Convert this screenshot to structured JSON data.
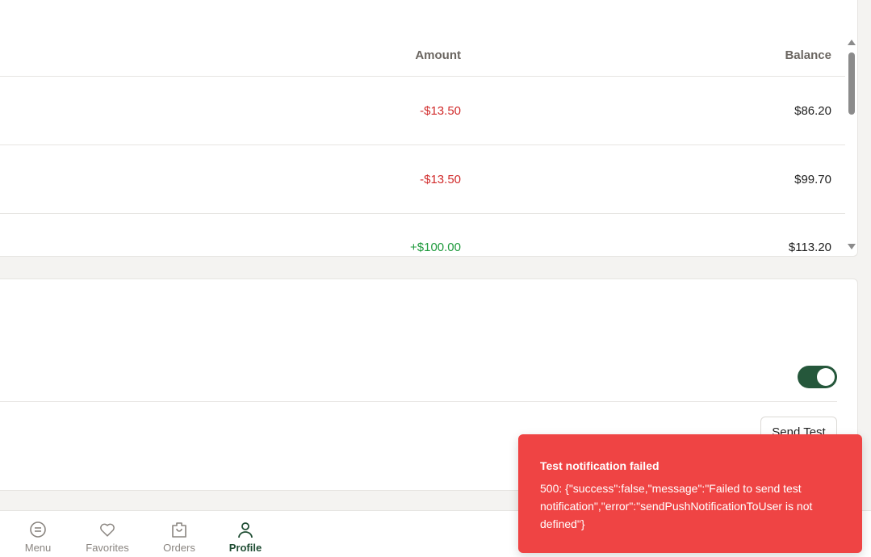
{
  "transactions": {
    "headers": {
      "amount": "Amount",
      "balance": "Balance"
    },
    "rows": [
      {
        "amount": "-$13.50",
        "balance": "$86.20"
      },
      {
        "amount": "-$13.50",
        "balance": "$99.70"
      },
      {
        "amount": "+$100.00",
        "balance": "$113.20"
      }
    ]
  },
  "notifications": {
    "toggle_on": true,
    "send_test_label": "Send Test"
  },
  "nav": {
    "items": [
      {
        "label": "Menu",
        "icon": "menu-icon"
      },
      {
        "label": "Favorites",
        "icon": "heart-icon"
      },
      {
        "label": "Orders",
        "icon": "bag-icon"
      },
      {
        "label": "Profile",
        "icon": "user-icon"
      }
    ],
    "active": "Profile"
  },
  "toast": {
    "title": "Test notification failed",
    "body": "500: {\"success\":false,\"message\":\"Failed to send test notification\",\"error\":\"sendPushNotificationToUser is not defined\"}"
  },
  "colors": {
    "accent": "#25573b",
    "negative": "#d12c2c",
    "positive": "#1f9a3d",
    "toast": "#ef4444"
  }
}
